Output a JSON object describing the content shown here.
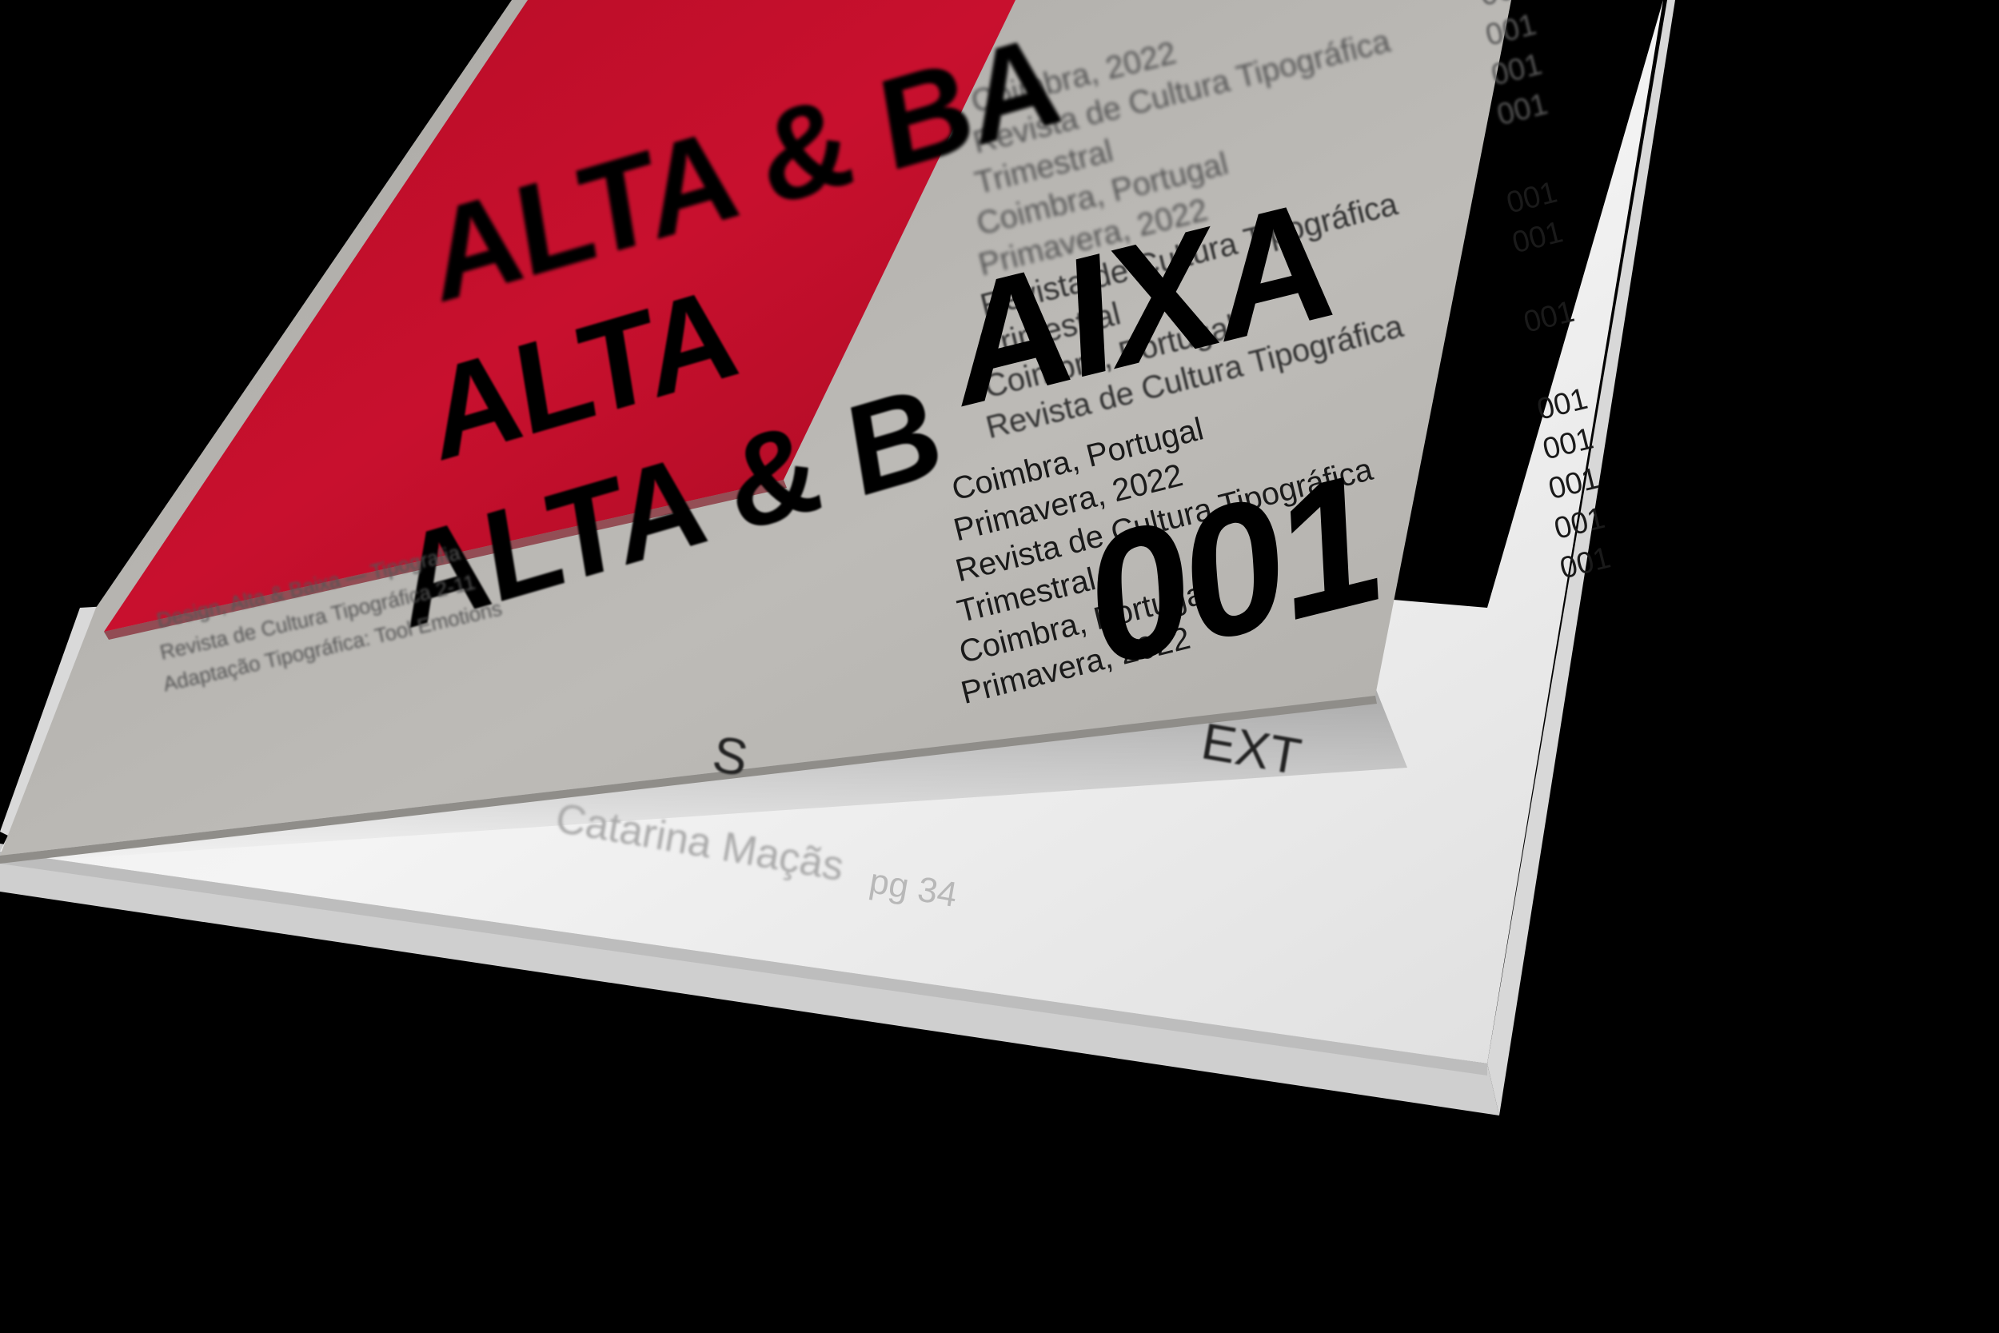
{
  "colors": {
    "background": "#000000",
    "red_card": "#c8102e",
    "grey_sheet": "#b6b4b0",
    "white_page": "#f2f2f2",
    "ink": "#000000"
  },
  "red_card": {
    "lines": [
      "ALTA & BA",
      "ALTA",
      "ALTA & B"
    ]
  },
  "grey_sheet": {
    "large_title": "AIXA",
    "large_number": "001",
    "lines_faint": [
      "Coimbra, 2022",
      "Revista de Cultura Tipográfica",
      "Trimestral",
      "Coimbra, Portugal",
      "Primavera, 2022",
      "Revista de Cultura Tipográfica",
      "Trimestral",
      "Coimbra, Portugal",
      "Revista de Cultura Tipográfica"
    ],
    "lines": [
      "Coimbra, Portugal",
      "Primavera, 2022",
      "Revista de Cultura Tipográfica",
      "Trimestral",
      "Coimbra, Portugal",
      "Primavera, 2022"
    ],
    "numbers": [
      "001",
      "001",
      "001",
      "001",
      "001",
      "001",
      "001",
      "001",
      "001",
      "001",
      "001",
      "001"
    ]
  },
  "white_page": {
    "text_cut_1": "EXT",
    "text_cut_2": "S",
    "author": "Catarina Maçãs",
    "page_label": "pg 34"
  },
  "cover_spine": {
    "lines": [
      "Design, Alta & Baixa — Tipografia",
      "Revista de Cultura Tipográfica 2-11",
      "Adaptação Tipográfica: Tool Emotions"
    ]
  }
}
